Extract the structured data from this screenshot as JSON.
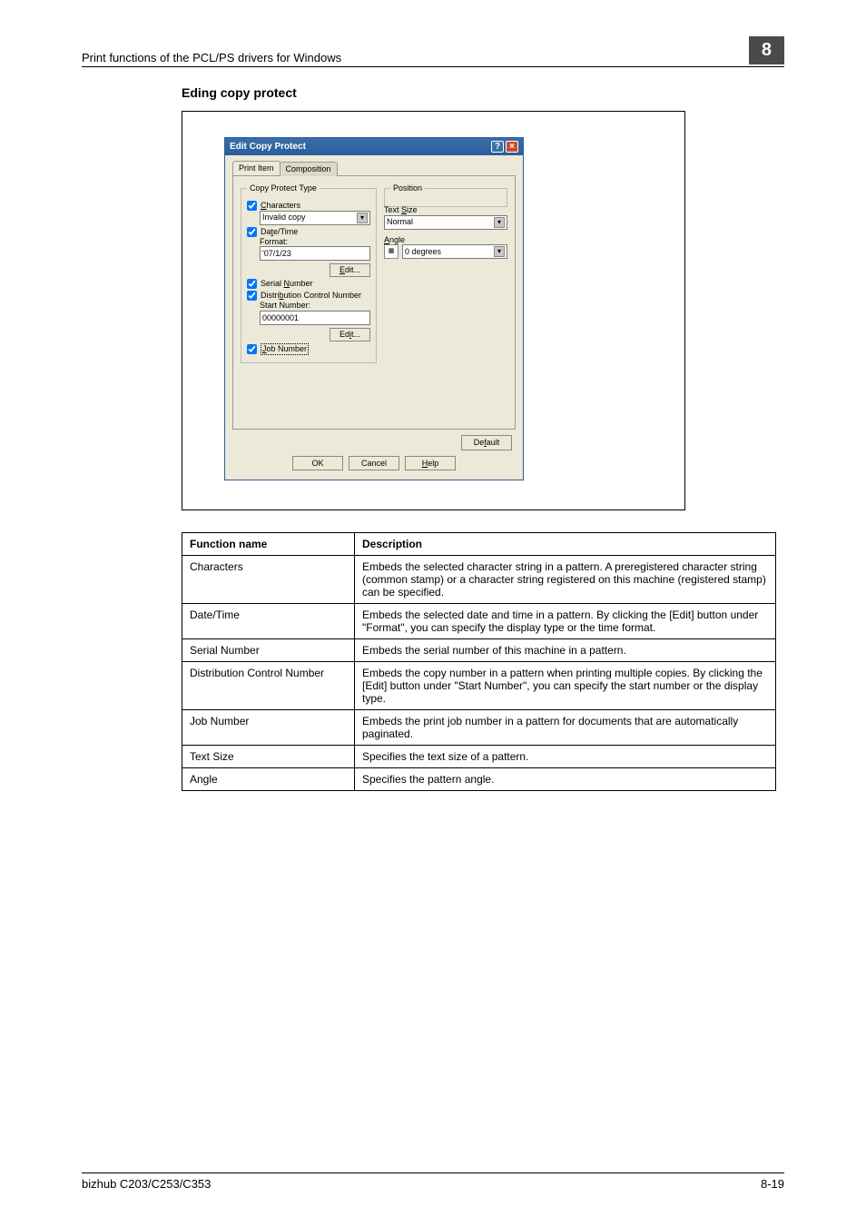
{
  "header": {
    "breadcrumb": "Print functions of the PCL/PS drivers for Windows",
    "chapter": "8"
  },
  "section_title": "Eding copy protect",
  "dialog": {
    "title": "Edit Copy Protect",
    "tabs": {
      "active": "Print Item",
      "inactive": "Composition"
    },
    "group_left": "Copy Protect Type",
    "characters": {
      "label": "Characters",
      "value": "Invalid copy"
    },
    "datetime": {
      "label": "Date/Time",
      "format_label": "Format:",
      "format_value": "'07/1/23",
      "edit": "Edit..."
    },
    "serial": {
      "label": "Serial Number"
    },
    "distribution": {
      "label": "Distribution Control Number",
      "start_label": "Start Number:",
      "start_value": "00000001",
      "edit": "Edit..."
    },
    "job": {
      "label": "Job Number"
    },
    "group_right": "Position",
    "textsize": {
      "label": "Text Size",
      "value": "Normal"
    },
    "angle": {
      "label": "Angle",
      "value": "0 degrees"
    },
    "default_btn": "Default",
    "ok": "OK",
    "cancel": "Cancel",
    "help": "Help"
  },
  "table": {
    "headers": [
      "Function name",
      "Description"
    ],
    "rows": [
      {
        "name": "Characters",
        "desc": "Embeds the selected character string in a pattern. A preregistered character string (common stamp) or a character string registered on this machine (registered stamp) can be specified."
      },
      {
        "name": "Date/Time",
        "desc": "Embeds the selected date and time in a pattern. By clicking the [Edit] button under \"Format\", you can specify the display type or the time format."
      },
      {
        "name": "Serial Number",
        "desc": "Embeds the serial number of this machine in a pattern."
      },
      {
        "name": "Distribution Control Number",
        "desc": "Embeds the copy number in a pattern when printing multiple copies. By clicking the [Edit] button under \"Start Number\", you can specify the start number or the display type."
      },
      {
        "name": "Job Number",
        "desc": "Embeds the print job number in a pattern for documents that are automatically paginated."
      },
      {
        "name": "Text Size",
        "desc": "Specifies the text size of a pattern."
      },
      {
        "name": "Angle",
        "desc": "Specifies the pattern angle."
      }
    ]
  },
  "footer": {
    "model": "bizhub C203/C253/C353",
    "page": "8-19"
  }
}
